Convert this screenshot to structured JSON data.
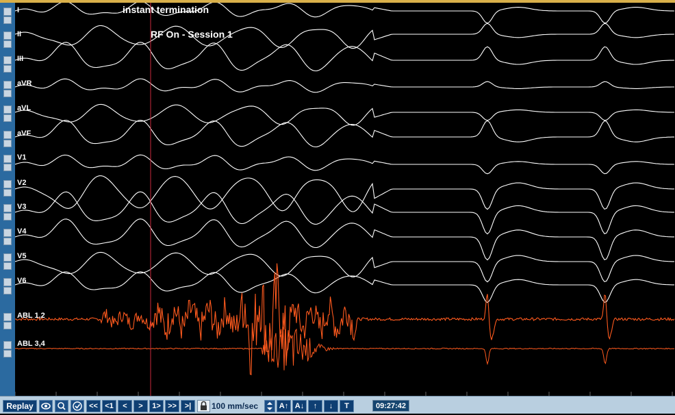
{
  "annotations": {
    "termination": "instant termination",
    "rf_on": "RF On - Session 1"
  },
  "leads": [
    {
      "label": "I"
    },
    {
      "label": "II"
    },
    {
      "label": "III"
    },
    {
      "label": "aVR"
    },
    {
      "label": "aVL"
    },
    {
      "label": "aVF"
    },
    {
      "label": "V1"
    },
    {
      "label": "V2"
    },
    {
      "label": "V3"
    },
    {
      "label": "V4"
    },
    {
      "label": "V5"
    },
    {
      "label": "V6"
    },
    {
      "label": "ABL 1,2"
    },
    {
      "label": "ABL 3,4"
    }
  ],
  "toolbar": {
    "replay": "Replay",
    "rewind_fast": "<<",
    "step_back_1": "<1",
    "back": "<",
    "forward": ">",
    "step_fwd_1": "1>",
    "forward_fast": ">>",
    "go_end": ">|",
    "speed": "100 mm/sec",
    "amp_up": "A↑",
    "amp_down": "A↓",
    "up": "↑",
    "down": "↓",
    "text_tool": "T",
    "time": "09:27:42"
  },
  "colors": {
    "surface_trace": "#ffffff",
    "abl_trace": "#ff5a1e",
    "rf_marker": "#c8283c",
    "panel": "#2b6aa0",
    "toolbar": "#b9cfe0"
  },
  "icons": [
    "eye-icon",
    "magnify-icon",
    "check-icon",
    "lock-icon",
    "speed-arrows-icon"
  ]
}
